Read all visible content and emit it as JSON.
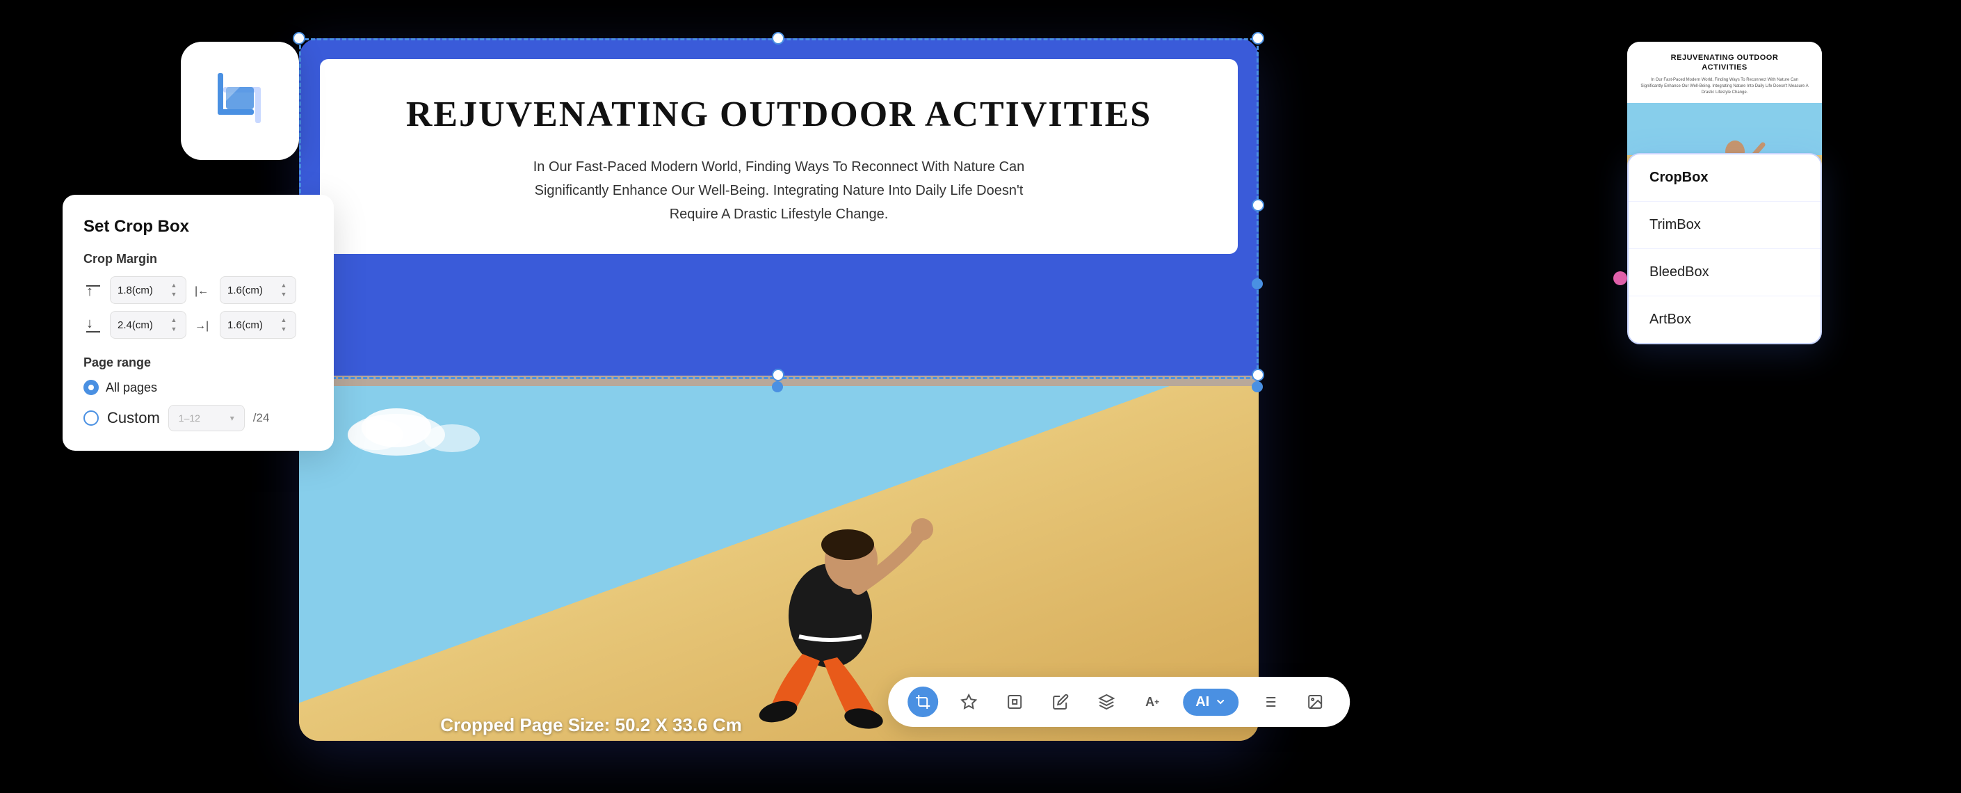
{
  "cropIconCard": {
    "label": "crop-icon"
  },
  "mainPreview": {
    "pdfTitle": "Rejuvenating Outdoor Activities",
    "pdfSubtitle": "In Our Fast-Paced Modern World, Finding Ways To Reconnect With Nature Can Significantly Enhance Our Well-Being. Integrating Nature Into Daily Life Doesn't Require A Drastic Lifestyle Change.",
    "croppedSizeLabel": "Cropped Page Size: 50.2 X 33.6 Cm"
  },
  "cropBoxPanel": {
    "title": "Set Crop Box",
    "cropMarginLabel": "Crop Margin",
    "topValue": "1.8(cm)",
    "leftValue": "1.6(cm)",
    "bottomValue": "2.4(cm)",
    "rightValue": "1.6(cm)",
    "pageRangeLabel": "Page range",
    "allPagesLabel": "All pages",
    "customLabel": "Custom",
    "pageInputPlaceholder": "1–12",
    "totalPages": "/24"
  },
  "cropDropdown": {
    "items": [
      {
        "label": "CropBox",
        "active": true
      },
      {
        "label": "TrimBox",
        "active": false
      },
      {
        "label": "BleedBox",
        "active": false
      },
      {
        "label": "ArtBox",
        "active": false
      }
    ]
  },
  "thumbnail": {
    "title": "Rejuvenating Outdoor\nActivities",
    "body": "In Our Fast-Paced Modern World, Finding Ways To Reconnect With Nature Can Significantly Enhance Our Well-Being. Integrating Nature Into Daily Life Doesn't Measure A Drastic Lifestyle Change."
  },
  "toolbar": {
    "buttons": [
      {
        "name": "crop-tool",
        "icon": "⬚",
        "active": true
      },
      {
        "name": "star-tool",
        "icon": "✦",
        "active": false
      },
      {
        "name": "box-tool",
        "icon": "▣",
        "active": false
      },
      {
        "name": "edit-tool",
        "icon": "✎",
        "active": false
      },
      {
        "name": "fill-tool",
        "icon": "⬡",
        "active": false
      },
      {
        "name": "text-tool",
        "icon": "A+",
        "active": false
      },
      {
        "name": "ai-tool",
        "label": "AI",
        "active": true
      },
      {
        "name": "list-tool",
        "icon": "≡",
        "active": false
      },
      {
        "name": "image-tool",
        "icon": "🖼",
        "active": false
      }
    ]
  }
}
